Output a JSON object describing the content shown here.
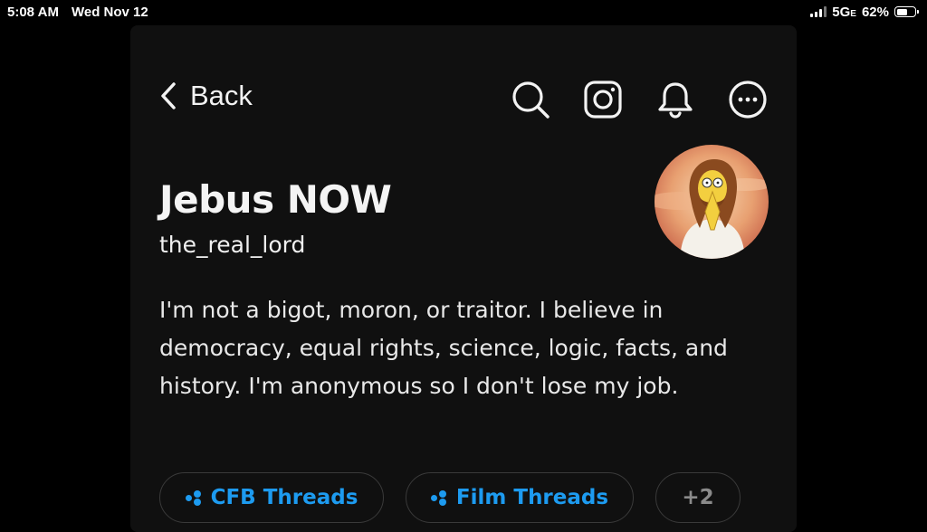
{
  "status_bar": {
    "time": "5:08 AM",
    "date": "Wed Nov 12",
    "network": "5G",
    "network_sub": "E",
    "battery": "62%",
    "battery_level": 0.62
  },
  "nav": {
    "back_label": "Back",
    "icons": [
      "search-icon",
      "instagram-icon",
      "bell-icon",
      "more-icon"
    ]
  },
  "profile": {
    "display_name": "Jebus NOW",
    "username": "the_real_lord",
    "bio": "I'm not a bigot, moron, or traitor. I believe in democracy, equal rights, science, logic, facts, and history. I'm anonymous so I don't lose my job."
  },
  "tags": [
    {
      "label": "CFB Threads"
    },
    {
      "label": "Film Threads"
    }
  ],
  "more_tags": "+2",
  "colors": {
    "background": "#000000",
    "panel": "#101010",
    "accent": "#1d9bf0",
    "text": "#f2f2f2",
    "muted": "#8a8a8a"
  }
}
